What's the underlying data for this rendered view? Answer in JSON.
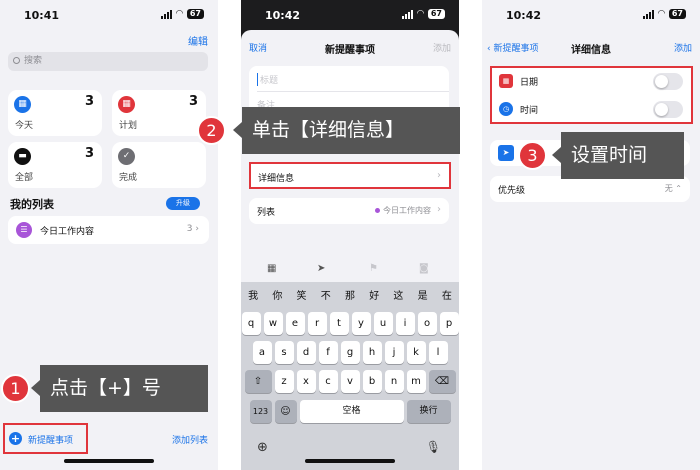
{
  "phone1": {
    "status_time": "10:41",
    "battery": "67",
    "edit": "编辑",
    "search_placeholder": "搜索",
    "cards": [
      {
        "label": "今天",
        "count": "3",
        "icon": "calendar-icon",
        "color": "#1a73e8"
      },
      {
        "label": "计划",
        "count": "3",
        "icon": "calendar-icon",
        "color": "#e0353b"
      },
      {
        "label": "全部",
        "count": "3",
        "icon": "tray-icon",
        "color": "#111111"
      },
      {
        "label": "完成",
        "count": "",
        "icon": "checkmark-icon",
        "color": "#6e6e73"
      }
    ],
    "my_lists": "我的列表",
    "upgrade": "升级",
    "list": {
      "name": "今日工作内容",
      "count": "3"
    },
    "new_reminder": "新提醒事项",
    "add_list": "添加列表"
  },
  "phone2": {
    "status_time": "10:42",
    "battery": "67",
    "cancel": "取消",
    "title": "新提醒事项",
    "add": "添加",
    "title_placeholder": "标题",
    "notes_placeholder": "备注",
    "details": "详细信息",
    "list_label": "列表",
    "list_value": "今日工作内容",
    "candidates": [
      "我",
      "你",
      "笑",
      "不",
      "那",
      "好",
      "这",
      "是",
      "在"
    ],
    "row1": [
      "q",
      "w",
      "e",
      "r",
      "t",
      "y",
      "u",
      "i",
      "o",
      "p"
    ],
    "row2": [
      "a",
      "s",
      "d",
      "f",
      "g",
      "h",
      "j",
      "k",
      "l"
    ],
    "row3": [
      "z",
      "x",
      "c",
      "v",
      "b",
      "n",
      "m"
    ],
    "key_123": "123",
    "space": "空格",
    "return": "换行"
  },
  "phone3": {
    "status_time": "10:42",
    "battery": "67",
    "back": "新提醒事项",
    "title": "详细信息",
    "add": "添加",
    "date": "日期",
    "time": "时间",
    "priority": "优先级",
    "priority_value": "无"
  },
  "callouts": [
    {
      "num": "1",
      "text": "点击【+】号"
    },
    {
      "num": "2",
      "text": "单击【详细信息】"
    },
    {
      "num": "3",
      "text": "设置时间"
    }
  ],
  "colors": {
    "accent": "#1a73e8",
    "highlight": "#e0353b",
    "callout_bg": "#555555"
  }
}
